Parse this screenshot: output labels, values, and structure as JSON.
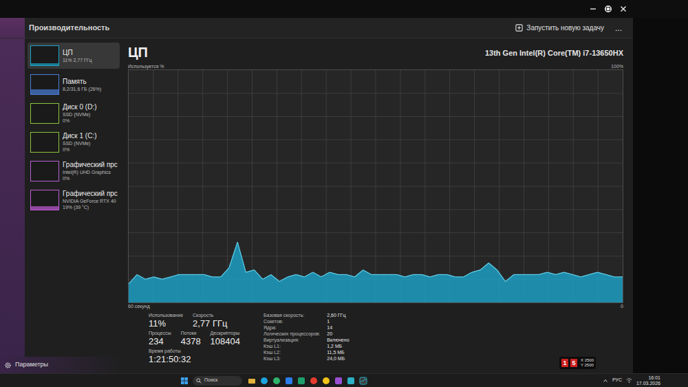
{
  "window": {
    "title": "Производительность"
  },
  "toolbar": {
    "run_task": "Запустить новую задачу",
    "more": "..."
  },
  "sidebar": {
    "items": [
      {
        "name": "ЦП",
        "lines": [
          "11% 2,77 ГГц"
        ],
        "selected": true,
        "level": 0.11,
        "color": "#1aa5c8"
      },
      {
        "name": "Память",
        "lines": [
          "8,2/31,6 ГБ (26%)"
        ],
        "selected": false,
        "level": 0.26,
        "color": "#4a7fd8"
      },
      {
        "name": "Диск 0 (D:)",
        "lines": [
          "SSD (NVMe)",
          "0%"
        ],
        "selected": false,
        "level": 0,
        "color": "#8cc43c"
      },
      {
        "name": "Диск 1 (C:)",
        "lines": [
          "SSD (NVMe)",
          "0%"
        ],
        "selected": false,
        "level": 0,
        "color": "#8cc43c"
      },
      {
        "name": "Графический прс",
        "lines": [
          "Intel(R) UHD Graphics",
          "0%"
        ],
        "selected": false,
        "level": 0,
        "color": "#b55fd1"
      },
      {
        "name": "Графический прс",
        "lines": [
          "NVIDIA GeForce RTX 40",
          "19% (39 °C)"
        ],
        "selected": false,
        "level": 0.19,
        "color": "#c05bd6"
      }
    ],
    "settings": "Параметры"
  },
  "main": {
    "title": "ЦП",
    "model": "13th Gen Intel(R) Core(TM) i7-13650HX"
  },
  "chart": {
    "y_label": "Используется %",
    "y_max_label": "100%",
    "x_label": "60 секунд",
    "x_end_label": "0",
    "y_max": 100,
    "series": [
      {
        "values": [
          8,
          12,
          10,
          11,
          10,
          11,
          12,
          12,
          12,
          12,
          11,
          11,
          15,
          26,
          13,
          14,
          10,
          12,
          9,
          11,
          12,
          11,
          13,
          11,
          13,
          12,
          12,
          11,
          14,
          12,
          12,
          12,
          12,
          11,
          12,
          12,
          11,
          12,
          12,
          11,
          11,
          13,
          14,
          17,
          14,
          9,
          12,
          12,
          12,
          12,
          13,
          12,
          13,
          12,
          11,
          12,
          13,
          12,
          11,
          11
        ]
      }
    ]
  },
  "stats": {
    "rows": [
      [
        {
          "label": "Использование",
          "value": "11%"
        },
        {
          "label": "Скорость",
          "value": "2,77 ГГц"
        }
      ],
      [
        {
          "label": "Процессы",
          "value": "234"
        },
        {
          "label": "Потоки",
          "value": "4378"
        },
        {
          "label": "Дескрипторы",
          "value": "108404"
        }
      ],
      [
        {
          "label": "Время работы",
          "value": "1:21:50:32"
        }
      ]
    ],
    "specs": [
      {
        "label": "Базовая скорость:",
        "value": "2,60 ГГц"
      },
      {
        "label": "Сокетов:",
        "value": "1"
      },
      {
        "label": "Ядра:",
        "value": "14"
      },
      {
        "label": "Логических процессоров:",
        "value": "20"
      },
      {
        "label": "Виртуализация:",
        "value": "Включено"
      },
      {
        "label": "Кэш L1:",
        "value": "1,2 МБ"
      },
      {
        "label": "Кэш L2:",
        "value": "11,5 МБ"
      },
      {
        "label": "Кэш L3:",
        "value": "24,0 МБ"
      }
    ]
  },
  "overlay": {
    "badges": [
      "1",
      "5"
    ],
    "lines": [
      "X 2500",
      "Y 2500"
    ]
  },
  "taskbar": {
    "search": "Поиск",
    "language": "РУС",
    "time": "16:01",
    "date": "17.03.2026"
  }
}
